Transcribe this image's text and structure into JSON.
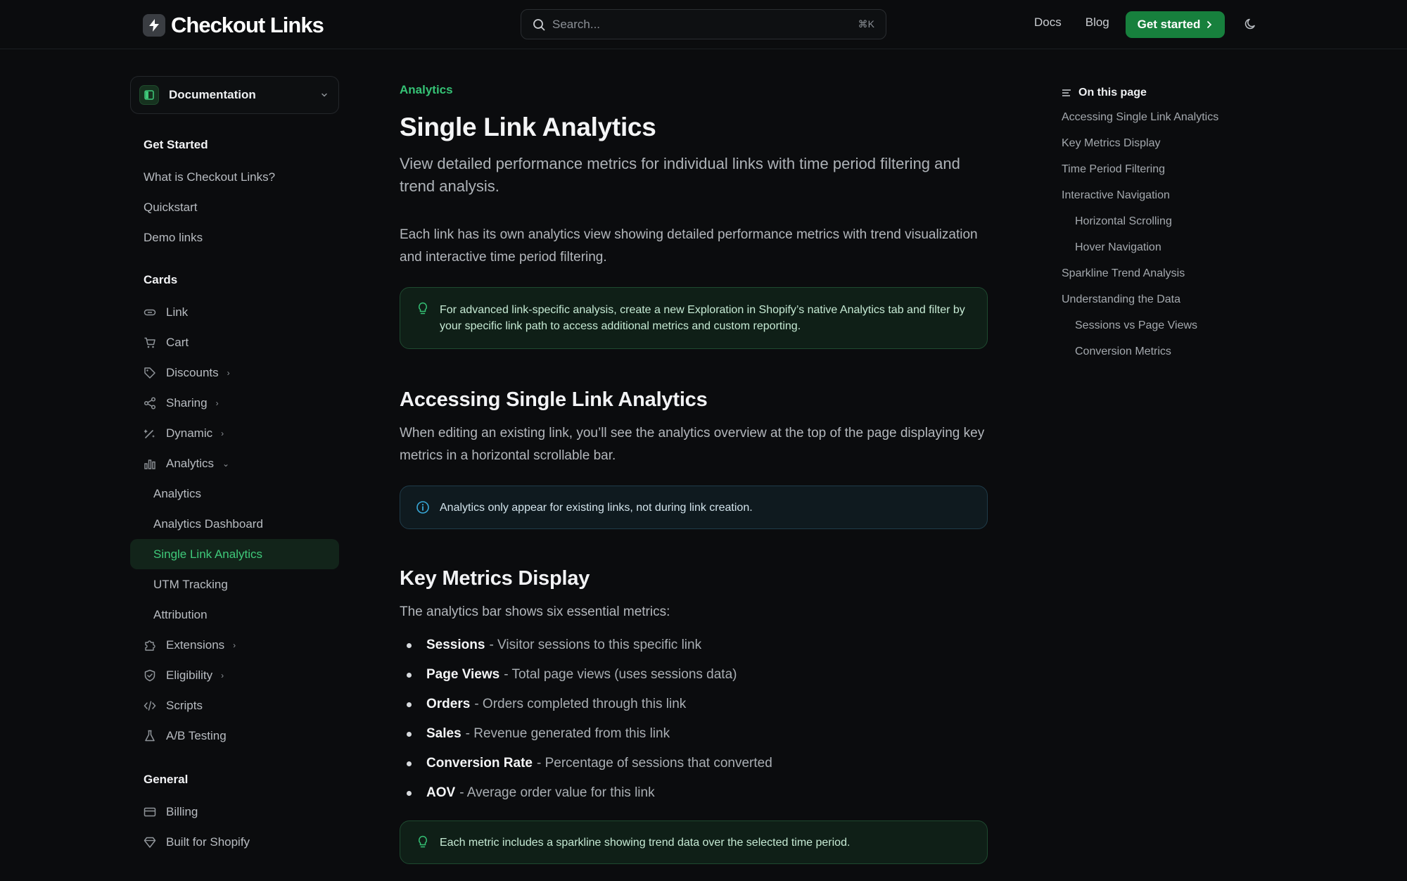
{
  "brand": {
    "name": "Checkout Links"
  },
  "search": {
    "placeholder": "Search...",
    "shortcut": "⌘K"
  },
  "topnav": {
    "docs": "Docs",
    "blog": "Blog",
    "cta": "Get started"
  },
  "sidebar": {
    "selector": "Documentation",
    "sections": [
      {
        "title": "Get Started",
        "items": [
          "What is Checkout Links?",
          "Quickstart",
          "Demo links"
        ]
      },
      {
        "title": "Cards",
        "items": [
          {
            "label": "Link",
            "icon": "link-icon"
          },
          {
            "label": "Cart",
            "icon": "cart-icon"
          },
          {
            "label": "Discounts",
            "icon": "tag-icon"
          },
          {
            "label": "Sharing",
            "icon": "share-icon"
          },
          {
            "label": "Dynamic",
            "icon": "wand-icon"
          },
          {
            "label": "Analytics",
            "icon": "bar-chart-icon"
          },
          {
            "label": "Analytics"
          },
          {
            "label": "Analytics Dashboard"
          },
          {
            "label": "Single Link Analytics"
          },
          {
            "label": "UTM Tracking"
          },
          {
            "label": "Attribution"
          },
          {
            "label": "Extensions",
            "icon": "puzzle-icon"
          },
          {
            "label": "Eligibility",
            "icon": "shield-icon"
          },
          {
            "label": "Scripts",
            "icon": "code-icon"
          },
          {
            "label": "A/B Testing",
            "icon": "flask-icon"
          }
        ]
      },
      {
        "title": "General",
        "items": [
          {
            "label": "Billing",
            "icon": "credit-card-icon"
          },
          {
            "label": "Built for Shopify",
            "icon": "gem-icon"
          }
        ]
      }
    ]
  },
  "main": {
    "eyebrow": "Analytics",
    "title": "Single Link Analytics",
    "lead": "View detailed performance metrics for individual links with time period filtering and trend analysis.",
    "intro": "Each link has its own analytics view showing detailed performance metrics with trend visualization and interactive time period filtering.",
    "tip1": "For advanced link-specific analysis, create a new Exploration in Shopify’s native Analytics tab and filter by your specific link path to access additional metrics and custom reporting.",
    "h_access": "Accessing Single Link Analytics",
    "access_body": "When editing an existing link, you’ll see the analytics overview at the top of the page displaying key metrics in a horizontal scrollable bar.",
    "info1": "Analytics only appear for existing links, not during link creation.",
    "h_metrics": "Key Metrics Display",
    "metrics_intro": "The analytics bar shows six essential metrics:",
    "metrics": [
      {
        "name": "Sessions",
        "desc": "- Visitor sessions to this specific link"
      },
      {
        "name": "Page Views",
        "desc": "- Total page views (uses sessions data)"
      },
      {
        "name": "Orders",
        "desc": "- Orders completed through this link"
      },
      {
        "name": "Sales",
        "desc": "- Revenue generated from this link"
      },
      {
        "name": "Conversion Rate",
        "desc": "- Percentage of sessions that converted"
      },
      {
        "name": "AOV",
        "desc": "- Average order value for this link"
      }
    ],
    "tip2": "Each metric includes a sparkline showing trend data over the selected time period."
  },
  "toc": {
    "title": "On this page",
    "items": [
      "Accessing Single Link Analytics",
      "Key Metrics Display",
      "Time Period Filtering",
      "Interactive Navigation",
      "Horizontal Scrolling",
      "Hover Navigation",
      "Sparkline Trend Analysis",
      "Understanding the Data",
      "Sessions vs Page Views",
      "Conversion Metrics"
    ]
  },
  "colors": {
    "accent": "#35c275",
    "cta": "#17803d",
    "background": "#0b0c0e"
  }
}
